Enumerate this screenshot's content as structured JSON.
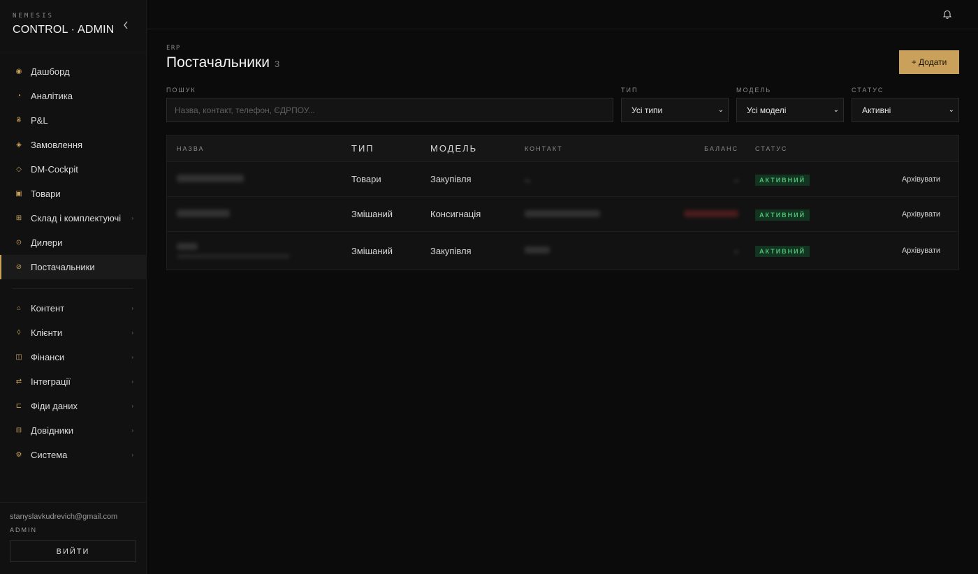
{
  "brand": {
    "sub": "NEMESIS",
    "title": "CONTROL · ADMIN"
  },
  "sidebar": {
    "items": [
      {
        "label": "Дашборд",
        "icon": "sun-icon"
      },
      {
        "label": "Аналітика",
        "icon": "pie-icon"
      },
      {
        "label": "P&L",
        "icon": "coin-icon"
      },
      {
        "label": "Замовлення",
        "icon": "diamond-icon"
      },
      {
        "label": "DM-Cockpit",
        "icon": "diamond-outline-icon"
      },
      {
        "label": "Товари",
        "icon": "square-icon"
      },
      {
        "label": "Склад і комплектуючі",
        "icon": "grid-icon"
      },
      {
        "label": "Дилери",
        "icon": "target-icon"
      },
      {
        "label": "Постачальники",
        "icon": "slash-circle-icon"
      }
    ],
    "groups": [
      {
        "label": "Контент",
        "icon": "home-icon"
      },
      {
        "label": "Клієнти",
        "icon": "drop-icon"
      },
      {
        "label": "Фінанси",
        "icon": "columns-icon"
      },
      {
        "label": "Інтеграції",
        "icon": "arrows-icon"
      },
      {
        "label": "Фіди даних",
        "icon": "bracket-icon"
      },
      {
        "label": "Довідники",
        "icon": "book-icon"
      },
      {
        "label": "Система",
        "icon": "gear-icon"
      }
    ],
    "active_item": "Постачальники"
  },
  "user": {
    "email": "stanyslavkudrevich@gmail.com",
    "role": "ADMIN",
    "logout_label": "ВИЙТИ"
  },
  "page": {
    "eyebrow": "ERP",
    "title": "Постачальники",
    "count": "3",
    "add_label": "+ Додати"
  },
  "filters": {
    "search_label": "ПОШУК",
    "search_placeholder": "Назва, контакт, телефон, ЄДРПОУ...",
    "type_label": "ТИП",
    "type_value": "Усі типи",
    "model_label": "МОДЕЛЬ",
    "model_value": "Усі моделі",
    "status_label": "СТАТУС",
    "status_value": "Активні"
  },
  "table": {
    "headers": {
      "name": "НАЗВА",
      "type": "ТИП",
      "model": "МОДЕЛЬ",
      "contact": "КОНТАКТ",
      "balance": "БАЛАНС",
      "status": "СТАТУС"
    },
    "rows": [
      {
        "type": "Товари",
        "model": "Закупівля",
        "status": "АКТИВНИЙ",
        "action": "Архівувати"
      },
      {
        "type": "Змішаний",
        "model": "Консигнація",
        "status": "АКТИВНИЙ",
        "action": "Архівувати"
      },
      {
        "type": "Змішаний",
        "model": "Закупівля",
        "status": "АКТИВНИЙ",
        "action": "Архівувати"
      }
    ]
  },
  "colors": {
    "accent": "#c9a15a",
    "status_green": "#4fbf73",
    "status_bg": "#123421"
  }
}
